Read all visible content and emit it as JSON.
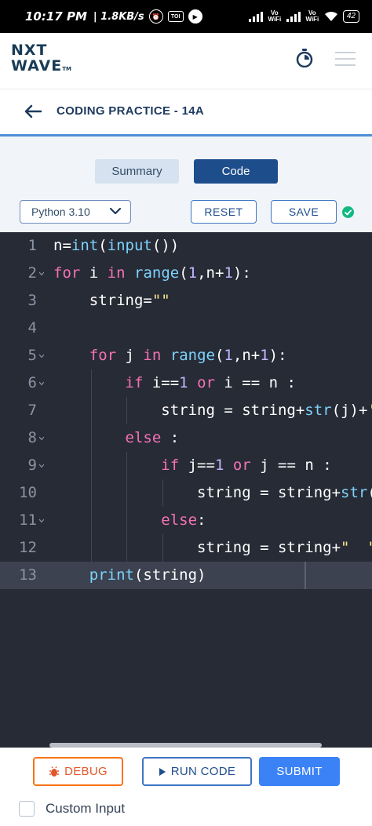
{
  "status_bar": {
    "time": "10:17 PM",
    "speed": "| 1.8KB/s",
    "left_icons": [
      "alarm-icon",
      "toi-icon",
      "messenger-icon"
    ],
    "toi_label": "TOI",
    "vowifi_1": "Vo WiFi",
    "vowifi_2": "Vo WiFi",
    "battery": "42"
  },
  "header": {
    "logo_line1": "NXT",
    "logo_line2": "WAVE",
    "logo_tm": "TM"
  },
  "title_bar": {
    "title": "CODING PRACTICE - 14A"
  },
  "tabs": [
    {
      "label": "Summary",
      "active": false
    },
    {
      "label": "Code",
      "active": true
    }
  ],
  "toolbar": {
    "language": "Python 3.10",
    "reset_label": "RESET",
    "save_label": "SAVE",
    "saved": true
  },
  "editor": {
    "lines": [
      {
        "n": "1",
        "fold": false,
        "text": "n=int(input())"
      },
      {
        "n": "2",
        "fold": true,
        "text": "for i in range(1,n+1):"
      },
      {
        "n": "3",
        "fold": false,
        "text": "    string=\"\""
      },
      {
        "n": "4",
        "fold": false,
        "text": ""
      },
      {
        "n": "5",
        "fold": true,
        "text": "    for j in range(1,n+1):"
      },
      {
        "n": "6",
        "fold": true,
        "text": "        if i==1 or i == n :"
      },
      {
        "n": "7",
        "fold": false,
        "text": "            string = string+str(j)+'"
      },
      {
        "n": "8",
        "fold": true,
        "text": "        else :"
      },
      {
        "n": "9",
        "fold": true,
        "text": "            if j==1 or j == n :"
      },
      {
        "n": "10",
        "fold": false,
        "text": "                string = string+str(j"
      },
      {
        "n": "11",
        "fold": true,
        "text": "            else:"
      },
      {
        "n": "12",
        "fold": false,
        "text": "                string = string+\"  \""
      },
      {
        "n": "13",
        "fold": false,
        "text": "    print(string)"
      }
    ],
    "active_line": "13"
  },
  "bottom": {
    "debug_label": "DEBUG",
    "run_label": "RUN CODE",
    "submit_label": "SUBMIT",
    "custom_input_label": "Custom Input",
    "custom_input_checked": false
  }
}
